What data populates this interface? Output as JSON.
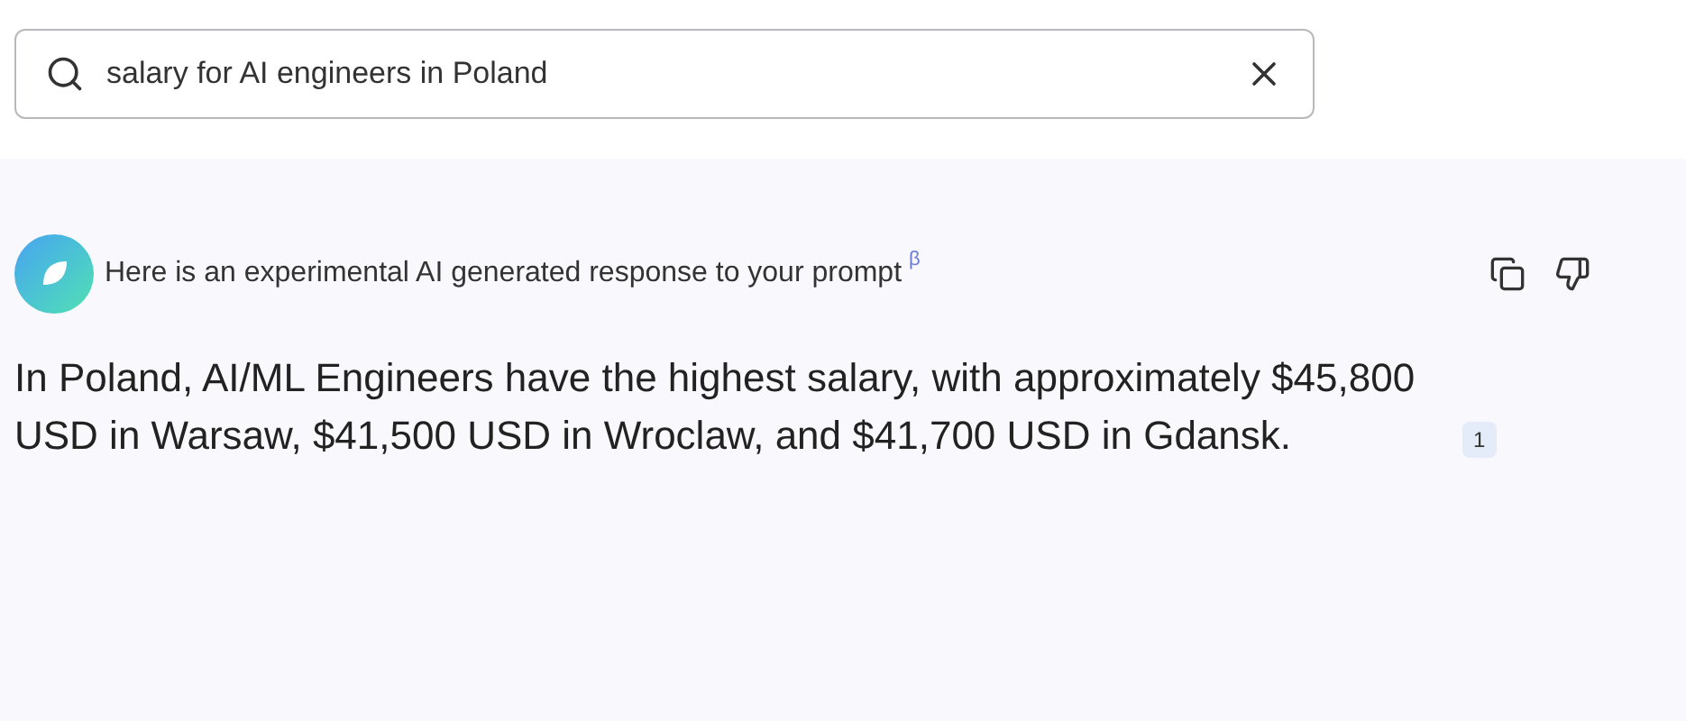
{
  "search": {
    "value": "salary for AI engineers in Poland"
  },
  "response": {
    "header": "Here is an experimental AI generated response to your prompt",
    "beta": "β",
    "answer": "In Poland, AI/ML Engineers have the highest salary, with approximately $45,800 USD in Warsaw, $41,500 USD in Wroclaw, and $41,700 USD in Gdansk.",
    "citation": "1"
  }
}
